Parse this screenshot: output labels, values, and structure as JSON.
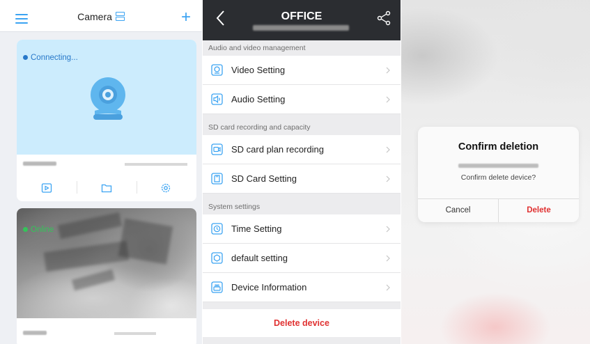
{
  "colors": {
    "accent": "#3ba3f2",
    "danger": "#e03131",
    "online": "#35c35a",
    "connecting": "#2778c9",
    "navbar": "#2b2d31"
  },
  "camera_list": {
    "title": "Camera",
    "icons": [
      "menu-icon",
      "grid-layout-icon",
      "plus-icon"
    ],
    "cards": [
      {
        "status": "Connecting...",
        "status_color": "#2778c9",
        "actions": [
          "playback-icon",
          "folder-icon",
          "settings-icon"
        ]
      },
      {
        "status": "Online",
        "status_color": "#35c35a"
      }
    ]
  },
  "settings": {
    "title": "OFFICE",
    "sections": [
      {
        "heading": "Audio and video management",
        "items": [
          {
            "label": "Video Setting",
            "icon": "video-icon"
          },
          {
            "label": "Audio Setting",
            "icon": "audio-icon"
          }
        ]
      },
      {
        "heading": "SD card recording and capacity",
        "items": [
          {
            "label": "SD card plan recording",
            "icon": "record-icon"
          },
          {
            "label": "SD Card Setting",
            "icon": "sd-card-icon"
          }
        ]
      },
      {
        "heading": "System settings",
        "items": [
          {
            "label": "Time Setting",
            "icon": "clock-icon"
          },
          {
            "label": "default setting",
            "icon": "reset-icon"
          },
          {
            "label": "Device Information",
            "icon": "info-icon"
          }
        ]
      }
    ],
    "delete_label": "Delete device"
  },
  "dialog": {
    "title": "Confirm deletion",
    "message": "Confirm delete device?",
    "cancel_label": "Cancel",
    "delete_label": "Delete"
  }
}
